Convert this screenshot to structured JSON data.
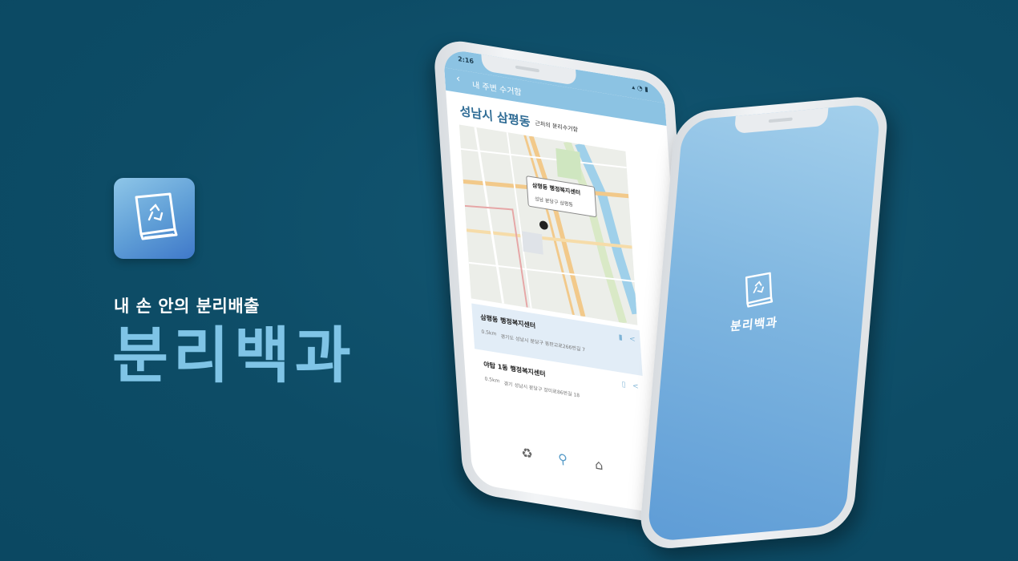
{
  "branding": {
    "tagline": "내 손 안의 분리배출",
    "title": "분리백과",
    "icon": "recycle-book-icon",
    "accent": "#7fc4e6",
    "background": "#0e4f6a"
  },
  "map_screen": {
    "status_time": "2:16",
    "status_icons": "▴ ◔ ▮",
    "nav": {
      "back_icon": "chevron-left-icon",
      "title": "내 주변 수거함"
    },
    "location": {
      "title": "성남시 삼평동",
      "subtitle": "근처의 분리수거함"
    },
    "callout": {
      "name": "삼평동 행정복지센터",
      "address": "성남 분당구 삼평동"
    },
    "results": [
      {
        "name": "삼평동 행정복지센터",
        "distance": "0.5km",
        "address": "경기도 성남시 분당구 동판교로266번길 7"
      },
      {
        "name": "야탑 1동 행정복지센터",
        "distance": "0.5km",
        "address": "경기 성남시 분당구 장미로86번길 18"
      }
    ],
    "tabs": [
      {
        "icon": "recycle-icon"
      },
      {
        "icon": "location-person-icon"
      },
      {
        "icon": "home-icon"
      }
    ]
  },
  "splash_screen": {
    "app_name": "분리백과"
  }
}
